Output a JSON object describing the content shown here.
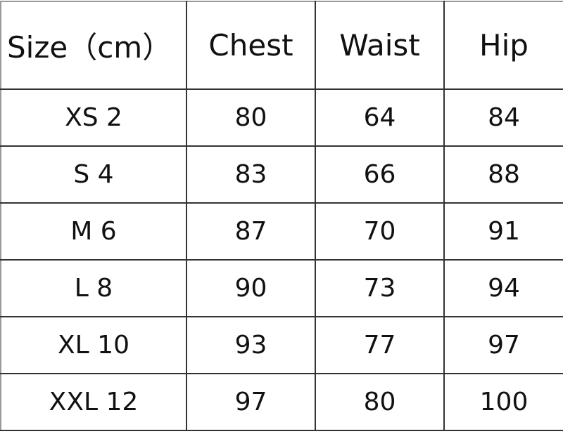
{
  "headers": [
    "Size（cm）",
    "Chest",
    "Waist",
    "Hip"
  ],
  "rows": [
    [
      "XS 2",
      "80",
      "64",
      "84"
    ],
    [
      "S 4",
      "83",
      "66",
      "88"
    ],
    [
      "M 6",
      "87",
      "70",
      "91"
    ],
    [
      "L 8",
      "90",
      "73",
      "94"
    ],
    [
      "XL 10",
      "93",
      "77",
      "97"
    ],
    [
      "XXL 12",
      "97",
      "80",
      "100"
    ]
  ]
}
